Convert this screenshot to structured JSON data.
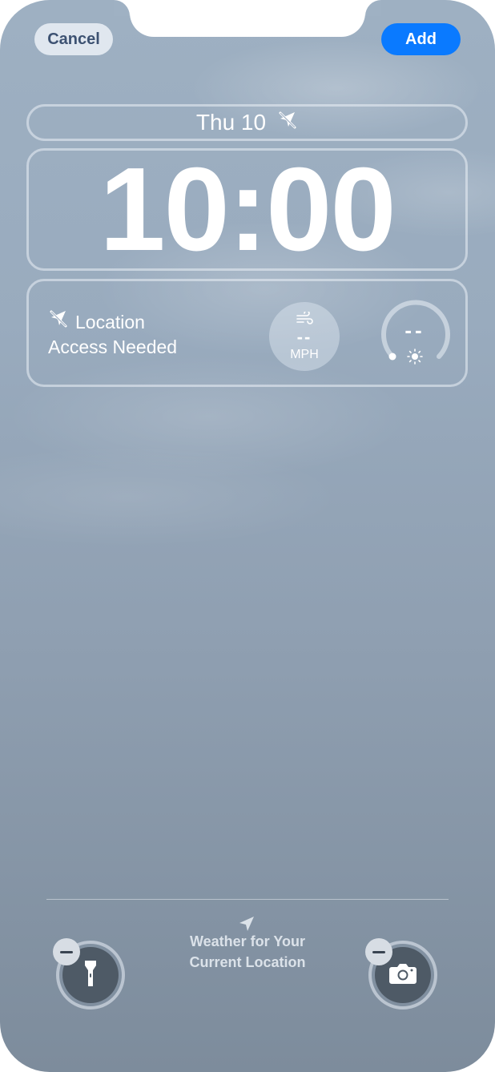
{
  "header": {
    "cancel_label": "Cancel",
    "add_label": "Add"
  },
  "lockscreen": {
    "date": "Thu 10",
    "time": "10:00"
  },
  "widgets": {
    "location_line1": "Location",
    "location_line2": "Access Needed",
    "wind_value": "--",
    "wind_unit": "MPH",
    "uv_value": "--"
  },
  "bottom": {
    "hint_line1": "Weather for Your",
    "hint_line2": "Current Location"
  },
  "icons": {
    "date_icon": "location-off-icon",
    "location_icon": "location-off-icon",
    "wind_icon": "wind-icon",
    "sun_icon": "sun-icon",
    "arrow_icon": "location-arrow-icon",
    "flashlight": "flashlight-icon",
    "camera": "camera-icon"
  },
  "colors": {
    "accent": "#0a7aff"
  }
}
